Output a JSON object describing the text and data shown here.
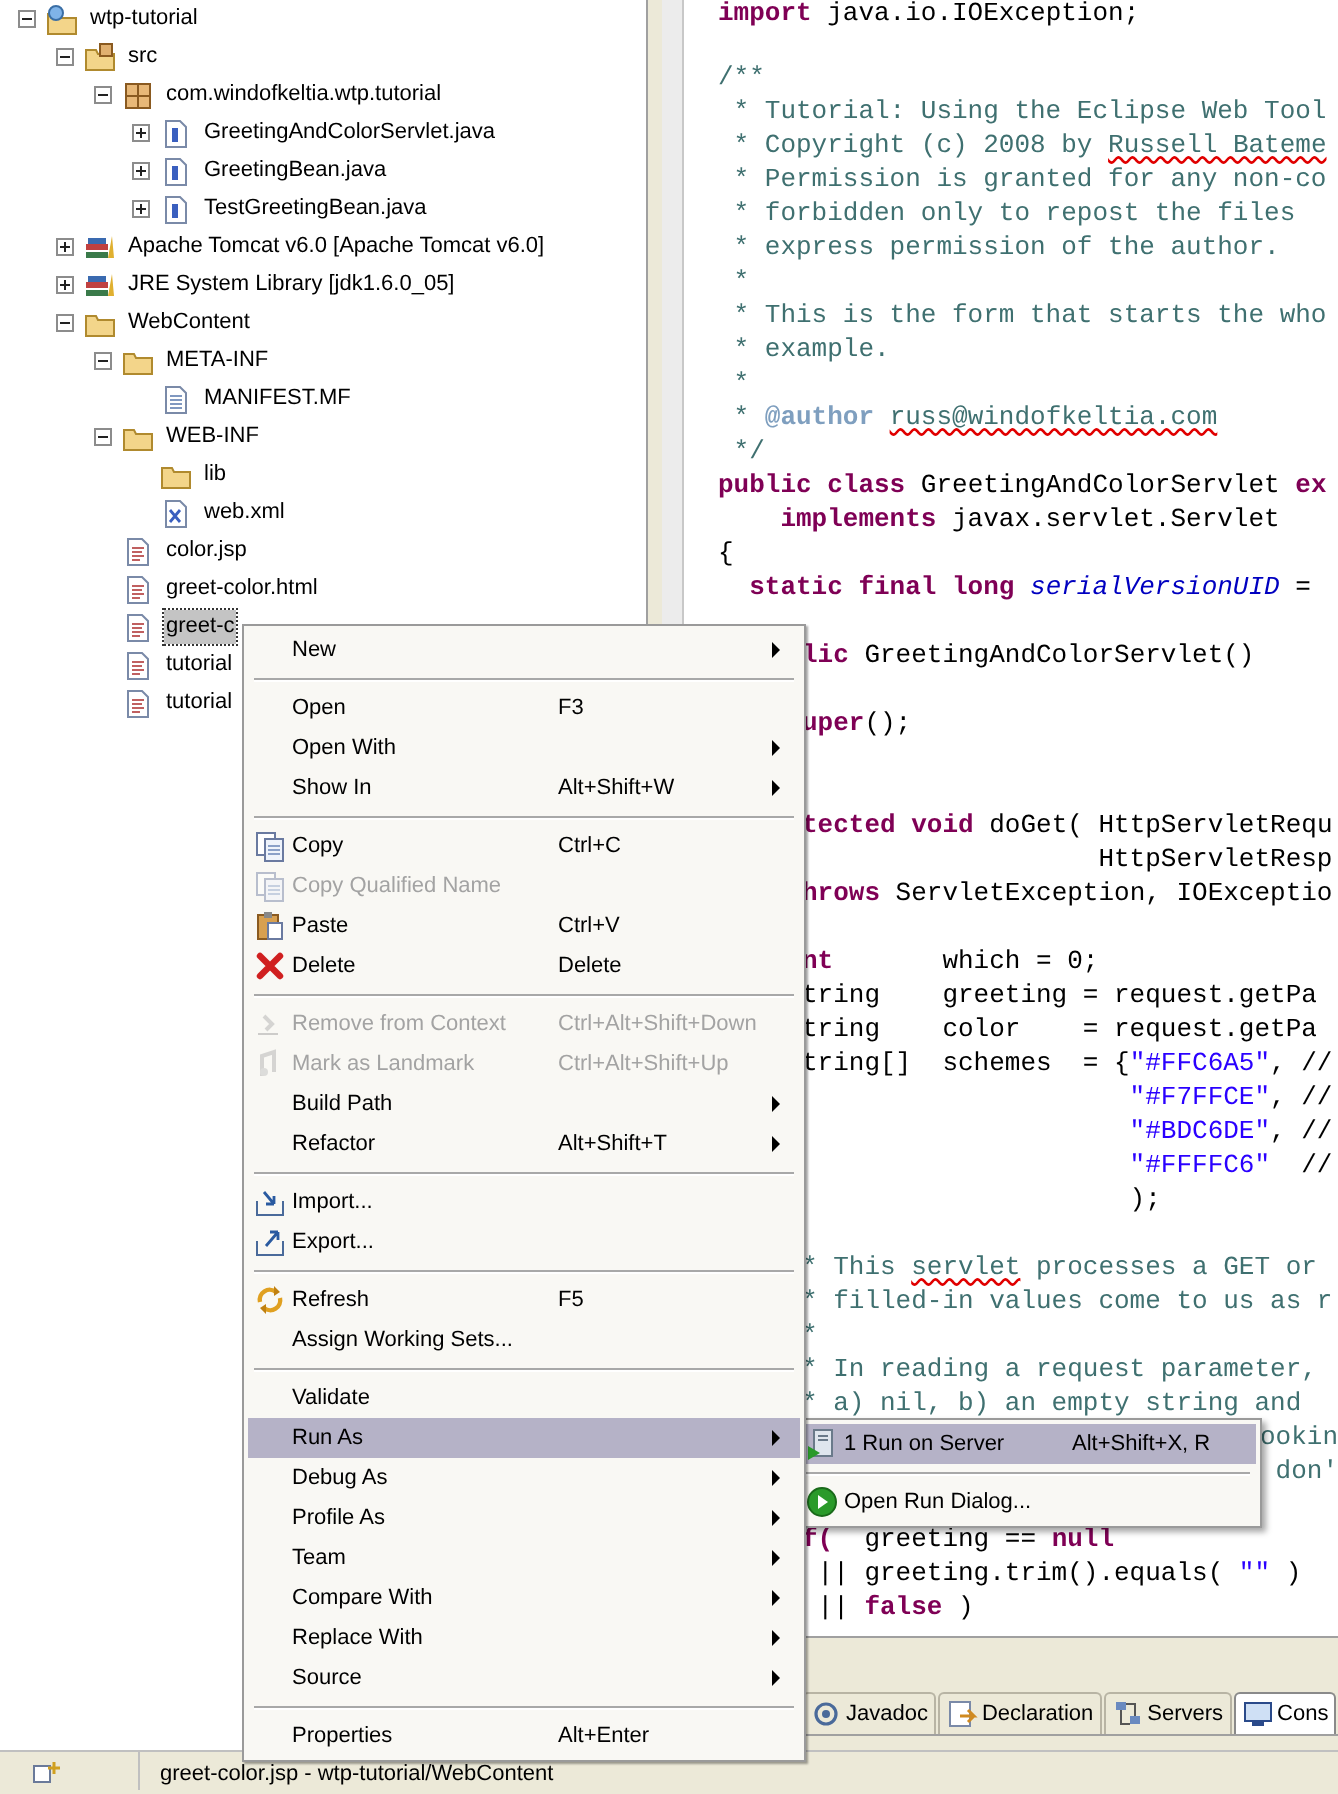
{
  "tree": [
    {
      "label": "wtp-tutorial",
      "kind": "project",
      "expanded": true,
      "selected": false,
      "children": [
        {
          "label": "src",
          "kind": "source-folder",
          "expanded": true,
          "selected": false,
          "children": [
            {
              "label": "com.windofkeltia.wtp.tutorial",
              "kind": "package",
              "expanded": true,
              "selected": false,
              "children": [
                {
                  "label": "GreetingAndColorServlet.java",
                  "kind": "java",
                  "expanded": false,
                  "selected": false
                },
                {
                  "label": "GreetingBean.java",
                  "kind": "java",
                  "expanded": false,
                  "selected": false
                },
                {
                  "label": "TestGreetingBean.java",
                  "kind": "java",
                  "expanded": false,
                  "selected": false
                }
              ]
            }
          ]
        },
        {
          "label": "Apache Tomcat v6.0 [Apache Tomcat v6.0]",
          "kind": "library",
          "expanded": false,
          "selected": false
        },
        {
          "label": "JRE System Library [jdk1.6.0_05]",
          "kind": "library",
          "expanded": false,
          "selected": false
        },
        {
          "label": "WebContent",
          "kind": "folder",
          "expanded": true,
          "selected": false,
          "children": [
            {
              "label": "META-INF",
              "kind": "folder",
              "expanded": true,
              "selected": false,
              "children": [
                {
                  "label": "MANIFEST.MF",
                  "kind": "text-file",
                  "selected": false
                }
              ]
            },
            {
              "label": "WEB-INF",
              "kind": "folder",
              "expanded": true,
              "selected": false,
              "children": [
                {
                  "label": "lib",
                  "kind": "folder",
                  "selected": false
                },
                {
                  "label": "web.xml",
                  "kind": "xml",
                  "selected": false
                }
              ]
            },
            {
              "label": "color.jsp",
              "kind": "web-file",
              "selected": false
            },
            {
              "label": "greet-color.html",
              "kind": "web-file",
              "selected": false
            },
            {
              "label": "greet-c",
              "kind": "web-file",
              "selected": true
            },
            {
              "label": "tutorial",
              "kind": "web-file",
              "selected": false
            },
            {
              "label": "tutorial",
              "kind": "web-file",
              "selected": false
            }
          ]
        }
      ]
    }
  ],
  "editor": {
    "lines": [
      {
        "kind": "top_edge",
        "segments": [
          {
            "kind": "keyword",
            "text": "import"
          },
          {
            "kind": "plain",
            "text": " java.io.IOException;"
          }
        ]
      },
      {
        "kind": "blank"
      },
      {
        "kind": "full",
        "segments": [
          {
            "kind": "comment",
            "text": "/**"
          }
        ]
      },
      {
        "kind": "full",
        "segments": [
          {
            "kind": "comment",
            "text": " * Tutorial: Using the Eclipse Web Tool"
          }
        ]
      },
      {
        "kind": "full",
        "segments": [
          {
            "kind": "comment",
            "text": " * Copyright (c) 2008 by "
          },
          {
            "kind": "spelling",
            "text": "Russell Bateme"
          }
        ]
      },
      {
        "kind": "full",
        "segments": [
          {
            "kind": "comment",
            "text": " * Permission is granted for any non-co"
          }
        ]
      },
      {
        "kind": "full",
        "segments": [
          {
            "kind": "comment",
            "text": " * forbidden only to repost the files"
          }
        ]
      },
      {
        "kind": "full",
        "segments": [
          {
            "kind": "comment",
            "text": " * express permission of the author."
          }
        ]
      },
      {
        "kind": "full",
        "segments": [
          {
            "kind": "comment",
            "text": " *"
          }
        ]
      },
      {
        "kind": "full",
        "segments": [
          {
            "kind": "comment",
            "text": " * This is the form that starts the who"
          }
        ]
      },
      {
        "kind": "full",
        "segments": [
          {
            "kind": "comment",
            "text": " * example."
          }
        ]
      },
      {
        "kind": "full",
        "segments": [
          {
            "kind": "comment",
            "text": " *"
          }
        ]
      },
      {
        "kind": "full",
        "segments": [
          {
            "kind": "comment",
            "text": " * "
          },
          {
            "kind": "doctag",
            "text": "@author "
          },
          {
            "kind": "spelling",
            "text": "russ@windofkeltia.com"
          }
        ]
      },
      {
        "kind": "full",
        "segments": [
          {
            "kind": "comment",
            "text": " */"
          }
        ]
      },
      {
        "kind": "full",
        "segments": [
          {
            "kind": "keyword",
            "text": "public class"
          },
          {
            "kind": "plain",
            "text": " GreetingAndColorServlet "
          },
          {
            "kind": "keyword",
            "text": "ex"
          }
        ]
      },
      {
        "kind": "full",
        "segments": [
          {
            "kind": "keyword",
            "text": "    implements"
          },
          {
            "kind": "plain",
            "text": " javax.servlet.Servlet"
          }
        ]
      },
      {
        "kind": "full",
        "segments": [
          {
            "kind": "plain",
            "text": "{"
          }
        ]
      },
      {
        "kind": "full",
        "segments": [
          {
            "kind": "keyword",
            "text": "  static final long "
          },
          {
            "kind": "field",
            "text": "serialVersionUID"
          },
          {
            "kind": "plain",
            "text": " ="
          }
        ]
      },
      {
        "kind": "blank"
      },
      {
        "kind": "beside_menu",
        "segments": [
          {
            "kind": "keyword",
            "text": "lic"
          },
          {
            "kind": "plain",
            "text": " GreetingAndColorServlet()"
          }
        ]
      },
      {
        "kind": "blank"
      },
      {
        "kind": "beside_menu",
        "segments": [
          {
            "kind": "keyword",
            "text": "uper"
          },
          {
            "kind": "plain",
            "text": "();"
          }
        ]
      },
      {
        "kind": "blank"
      },
      {
        "kind": "blank"
      },
      {
        "kind": "beside_menu",
        "segments": [
          {
            "kind": "keyword",
            "text": "tected void"
          },
          {
            "kind": "plain",
            "text": " doGet( HttpServletRequ"
          }
        ]
      },
      {
        "kind": "beside_menu",
        "segments": [
          {
            "kind": "plain",
            "text": "                   HttpServletResp"
          }
        ]
      },
      {
        "kind": "beside_menu",
        "segments": [
          {
            "kind": "keyword",
            "text": "hrows"
          },
          {
            "kind": "plain",
            "text": " ServletException, IOExceptio"
          }
        ]
      },
      {
        "kind": "blank"
      },
      {
        "kind": "beside_menu",
        "segments": [
          {
            "kind": "keyword",
            "text": "nt"
          },
          {
            "kind": "plain",
            "text": "       which = 0;"
          }
        ]
      },
      {
        "kind": "beside_menu",
        "segments": [
          {
            "kind": "plain",
            "text": "tring    greeting = request.getPa"
          }
        ]
      },
      {
        "kind": "beside_menu",
        "segments": [
          {
            "kind": "plain",
            "text": "tring    color    = request.getPa"
          }
        ]
      },
      {
        "kind": "beside_menu",
        "segments": [
          {
            "kind": "plain",
            "text": "tring[]  schemes  = {"
          },
          {
            "kind": "string",
            "text": "\"#FFC6A5\""
          },
          {
            "kind": "plain",
            "text": ", //"
          }
        ]
      },
      {
        "kind": "beside_menu",
        "segments": [
          {
            "kind": "string",
            "text": "                     \"#F7FFCE\""
          },
          {
            "kind": "plain",
            "text": ", //"
          }
        ]
      },
      {
        "kind": "beside_menu",
        "segments": [
          {
            "kind": "string",
            "text": "                     \"#BDC6DE\""
          },
          {
            "kind": "plain",
            "text": ", //"
          }
        ]
      },
      {
        "kind": "beside_menu",
        "segments": [
          {
            "kind": "string",
            "text": "                     \"#FFFFC6\""
          },
          {
            "kind": "plain",
            "text": "  //"
          }
        ]
      },
      {
        "kind": "beside_menu",
        "segments": [
          {
            "kind": "plain",
            "text": "                     );"
          }
        ]
      },
      {
        "kind": "blank"
      },
      {
        "kind": "beside_menu",
        "segments": [
          {
            "kind": "comment",
            "text": "* This "
          },
          {
            "kind": "spelling",
            "text": "servlet"
          },
          {
            "kind": "comment",
            "text": " processes a GET or"
          }
        ]
      },
      {
        "kind": "beside_menu",
        "segments": [
          {
            "kind": "comment",
            "text": "* filled-in values come to us as r"
          }
        ]
      },
      {
        "kind": "beside_menu",
        "segments": [
          {
            "kind": "comment",
            "text": "*"
          }
        ]
      },
      {
        "kind": "beside_menu",
        "segments": [
          {
            "kind": "comment",
            "text": "* In reading a request parameter,"
          }
        ]
      },
      {
        "kind": "beside_menu",
        "segments": [
          {
            "kind": "comment",
            "text": "* a) nil, b) an empty string and"
          }
        ]
      },
      {
        "kind": "beside_submenu",
        "segments": [
          {
            "kind": "comment",
            "text": "ookin"
          }
        ]
      },
      {
        "kind": "beside_submenu",
        "segments": [
          {
            "kind": "comment",
            "text": " don'"
          }
        ]
      },
      {
        "kind": "blank"
      },
      {
        "kind": "beside_menu",
        "segments": [
          {
            "kind": "keyword",
            "text": "f("
          },
          {
            "kind": "plain",
            "text": "  greeting == "
          },
          {
            "kind": "keyword",
            "text": "null"
          }
        ]
      },
      {
        "kind": "beside_menu",
        "segments": [
          {
            "kind": "plain",
            "text": " || greeting.trim().equals( "
          },
          {
            "kind": "string",
            "text": "\"\""
          },
          {
            "kind": "plain",
            "text": " )"
          }
        ]
      },
      {
        "kind": "beside_menu",
        "segments": [
          {
            "kind": "plain",
            "text": " || "
          },
          {
            "kind": "keyword",
            "text": "false"
          },
          {
            "kind": "plain",
            "text": " )"
          }
        ]
      }
    ]
  },
  "view_tabs": [
    {
      "label": "Javadoc",
      "kind": "javadoc",
      "selected": false
    },
    {
      "label": "Declaration",
      "kind": "declaration",
      "selected": false
    },
    {
      "label": "Servers",
      "kind": "servers",
      "selected": false
    },
    {
      "label": "Cons",
      "kind": "console",
      "selected": true
    }
  ],
  "context_menu": {
    "items": [
      {
        "kind": "plain",
        "label": "New",
        "submenu": true,
        "disabled": false,
        "selected": false
      },
      {
        "kind": "separator"
      },
      {
        "kind": "plain",
        "label": "Open",
        "shortcut": "F3",
        "submenu": false,
        "disabled": false,
        "selected": false
      },
      {
        "kind": "plain",
        "label": "Open With",
        "submenu": true,
        "disabled": false,
        "selected": false
      },
      {
        "kind": "plain",
        "label": "Show In",
        "shortcut": "Alt+Shift+W",
        "submenu": true,
        "disabled": false,
        "selected": false
      },
      {
        "kind": "separator"
      },
      {
        "kind": "copy",
        "label": "Copy",
        "shortcut": "Ctrl+C",
        "submenu": false,
        "disabled": false,
        "selected": false
      },
      {
        "kind": "copy",
        "label": "Copy Qualified Name",
        "submenu": false,
        "disabled": true,
        "selected": false
      },
      {
        "kind": "paste",
        "label": "Paste",
        "shortcut": "Ctrl+V",
        "submenu": false,
        "disabled": false,
        "selected": false
      },
      {
        "kind": "delete",
        "label": "Delete",
        "shortcut": "Delete",
        "submenu": false,
        "disabled": false,
        "selected": false
      },
      {
        "kind": "separator"
      },
      {
        "kind": "remove-context",
        "label": "Remove from Context",
        "shortcut": "Ctrl+Alt+Shift+Down",
        "submenu": false,
        "disabled": true,
        "selected": false
      },
      {
        "kind": "landmark",
        "label": "Mark as Landmark",
        "shortcut": "Ctrl+Alt+Shift+Up",
        "submenu": false,
        "disabled": true,
        "selected": false
      },
      {
        "kind": "plain",
        "label": "Build Path",
        "submenu": true,
        "disabled": false,
        "selected": false
      },
      {
        "kind": "plain",
        "label": "Refactor",
        "shortcut": "Alt+Shift+T",
        "submenu": true,
        "disabled": false,
        "selected": false
      },
      {
        "kind": "separator"
      },
      {
        "kind": "import",
        "label": "Import...",
        "submenu": false,
        "disabled": false,
        "selected": false
      },
      {
        "kind": "export",
        "label": "Export...",
        "submenu": false,
        "disabled": false,
        "selected": false
      },
      {
        "kind": "separator"
      },
      {
        "kind": "refresh",
        "label": "Refresh",
        "shortcut": "F5",
        "submenu": false,
        "disabled": false,
        "selected": false
      },
      {
        "kind": "plain",
        "label": "Assign Working Sets...",
        "submenu": false,
        "disabled": false,
        "selected": false
      },
      {
        "kind": "separator"
      },
      {
        "kind": "plain",
        "label": "Validate",
        "submenu": false,
        "disabled": false,
        "selected": false
      },
      {
        "kind": "plain",
        "label": "Run As",
        "submenu": true,
        "disabled": false,
        "selected": true
      },
      {
        "kind": "plain",
        "label": "Debug As",
        "submenu": true,
        "disabled": false,
        "selected": false
      },
      {
        "kind": "plain",
        "label": "Profile As",
        "submenu": true,
        "disabled": false,
        "selected": false
      },
      {
        "kind": "plain",
        "label": "Team",
        "submenu": true,
        "disabled": false,
        "selected": false
      },
      {
        "kind": "plain",
        "label": "Compare With",
        "submenu": true,
        "disabled": false,
        "selected": false
      },
      {
        "kind": "plain",
        "label": "Replace With",
        "submenu": true,
        "disabled": false,
        "selected": false
      },
      {
        "kind": "plain",
        "label": "Source",
        "submenu": true,
        "disabled": false,
        "selected": false
      },
      {
        "kind": "separator"
      },
      {
        "kind": "plain",
        "label": "Properties",
        "shortcut": "Alt+Enter",
        "submenu": false,
        "disabled": false,
        "selected": false
      }
    ]
  },
  "submenu": {
    "items": [
      {
        "kind": "run-server",
        "label": "1 Run on Server",
        "shortcut": "Alt+Shift+X, R",
        "selected": true
      },
      {
        "kind": "separator"
      },
      {
        "kind": "run-dialog",
        "label": "Open Run Dialog...",
        "selected": false
      }
    ]
  },
  "status_bar": {
    "text": "greet-color.jsp - wtp-tutorial/WebContent"
  }
}
